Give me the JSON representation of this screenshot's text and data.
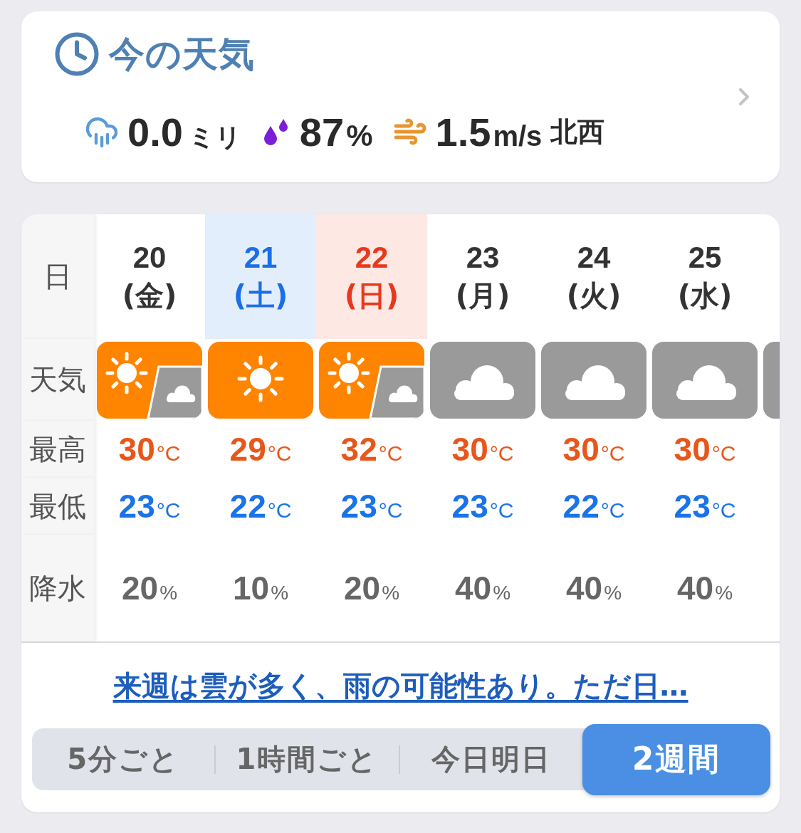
{
  "current_weather": {
    "title": "今の天気",
    "precipitation": {
      "value": "0.0",
      "unit": "ミリ"
    },
    "humidity": {
      "value": "87",
      "unit": "%"
    },
    "wind": {
      "value": "1.5",
      "unit": "m/s",
      "direction": "北西"
    }
  },
  "forecast": {
    "row_labels": [
      "日",
      "天気",
      "最高",
      "最低",
      "降水"
    ],
    "days": [
      {
        "date": "20",
        "weekday": "(金)",
        "kind": "weekday",
        "weather": {
          "kind": "mixed"
        },
        "high": "30",
        "high_unit": "°C",
        "low": "23",
        "low_unit": "°C",
        "precip": "20",
        "precip_unit": "%"
      },
      {
        "date": "21",
        "weekday": "(土)",
        "kind": "saturday",
        "weather": {
          "kind": "sunny"
        },
        "high": "29",
        "high_unit": "°C",
        "low": "22",
        "low_unit": "°C",
        "precip": "10",
        "precip_unit": "%"
      },
      {
        "date": "22",
        "weekday": "(日)",
        "kind": "sunday",
        "weather": {
          "kind": "mixed"
        },
        "high": "32",
        "high_unit": "°C",
        "low": "23",
        "low_unit": "°C",
        "precip": "20",
        "precip_unit": "%"
      },
      {
        "date": "23",
        "weekday": "(月)",
        "kind": "weekday",
        "weather": {
          "kind": "cloudy"
        },
        "high": "30",
        "high_unit": "°C",
        "low": "23",
        "low_unit": "°C",
        "precip": "40",
        "precip_unit": "%"
      },
      {
        "date": "24",
        "weekday": "(火)",
        "kind": "weekday",
        "weather": {
          "kind": "cloudy"
        },
        "high": "30",
        "high_unit": "°C",
        "low": "22",
        "low_unit": "°C",
        "precip": "40",
        "precip_unit": "%"
      },
      {
        "date": "25",
        "weekday": "(水)",
        "kind": "weekday",
        "weather": {
          "kind": "cloudy"
        },
        "high": "30",
        "high_unit": "°C",
        "low": "23",
        "low_unit": "°C",
        "precip": "40",
        "precip_unit": "%"
      }
    ],
    "next_day": {
      "weather": {
        "kind": "cloudy"
      }
    }
  },
  "summary_link": "来週は雲が多く、雨の可能性あり。ただ日…",
  "tabs": [
    {
      "label": "5分ごと",
      "selected": false
    },
    {
      "label": "1時間ごと",
      "selected": false
    },
    {
      "label": "今日明日",
      "selected": false
    },
    {
      "label": "2週間",
      "selected": true
    }
  ]
}
